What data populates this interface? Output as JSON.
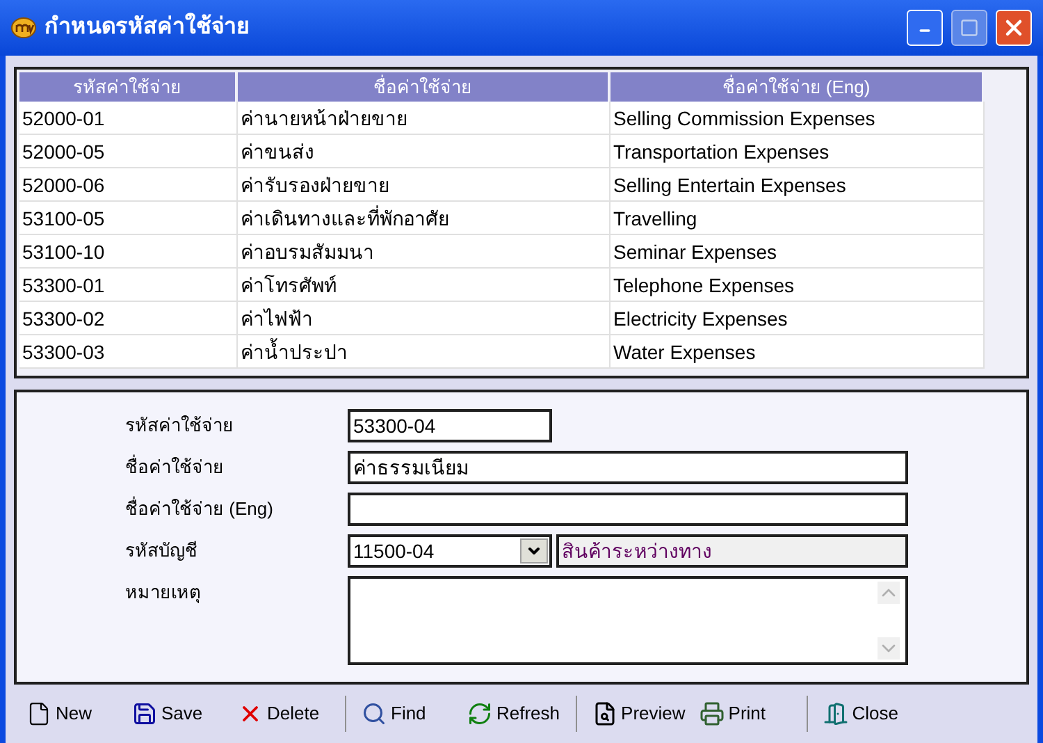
{
  "window": {
    "title": "กำหนดรหัสค่าใช้จ่าย"
  },
  "table": {
    "columns": [
      "รหัสค่าใช้จ่าย",
      "ชื่อค่าใช้จ่าย",
      "ชื่อค่าใช้จ่าย (Eng)"
    ],
    "rows": [
      [
        "52000-01",
        "ค่านายหน้าฝ่ายขาย",
        "Selling Commission Expenses"
      ],
      [
        "52000-05",
        "ค่าขนส่ง",
        "Transportation Expenses"
      ],
      [
        "52000-06",
        "ค่ารับรองฝ่ายขาย",
        "Selling Entertain Expenses"
      ],
      [
        "53100-05",
        "ค่าเดินทางและที่พักอาศัย",
        "Travelling"
      ],
      [
        "53100-10",
        "ค่าอบรมสัมมนา",
        "Seminar Expenses"
      ],
      [
        "53300-01",
        "ค่าโทรศัพท์",
        "Telephone Expenses"
      ],
      [
        "53300-02",
        "ค่าไฟฟ้า",
        "Electricity Expenses"
      ],
      [
        "53300-03",
        "ค่าน้ำประปา",
        "Water Expenses"
      ]
    ]
  },
  "form": {
    "fields": [
      {
        "kind": "short",
        "label": "รหัสค่าใช้จ่าย",
        "value": "53300-04"
      },
      {
        "kind": "text",
        "label": "ชื่อค่าใช้จ่าย",
        "value": "ค่าธรรมเนียม"
      },
      {
        "kind": "text",
        "label": "ชื่อค่าใช้จ่าย (Eng)"
      },
      {
        "kind": "combo",
        "label": "รหัสบัญชี",
        "value": "11500-04",
        "description": "สินค้าระหว่างทาง"
      },
      {
        "kind": "memo",
        "label": "หมายเหตุ"
      }
    ]
  },
  "toolbar": [
    {
      "kind": "new",
      "label": "New",
      "separator_before": false
    },
    {
      "kind": "save",
      "label": "Save",
      "separator_before": false
    },
    {
      "kind": "delete",
      "label": "Delete",
      "separator_before": false
    },
    {
      "kind": "find",
      "label": "Find",
      "separator_before": true
    },
    {
      "kind": "refresh",
      "label": "Refresh",
      "separator_before": false
    },
    {
      "kind": "preview",
      "label": "Preview",
      "separator_before": true
    },
    {
      "kind": "print",
      "label": "Print",
      "separator_before": false
    },
    {
      "kind": "close",
      "label": "Close",
      "separator_before": true
    }
  ]
}
